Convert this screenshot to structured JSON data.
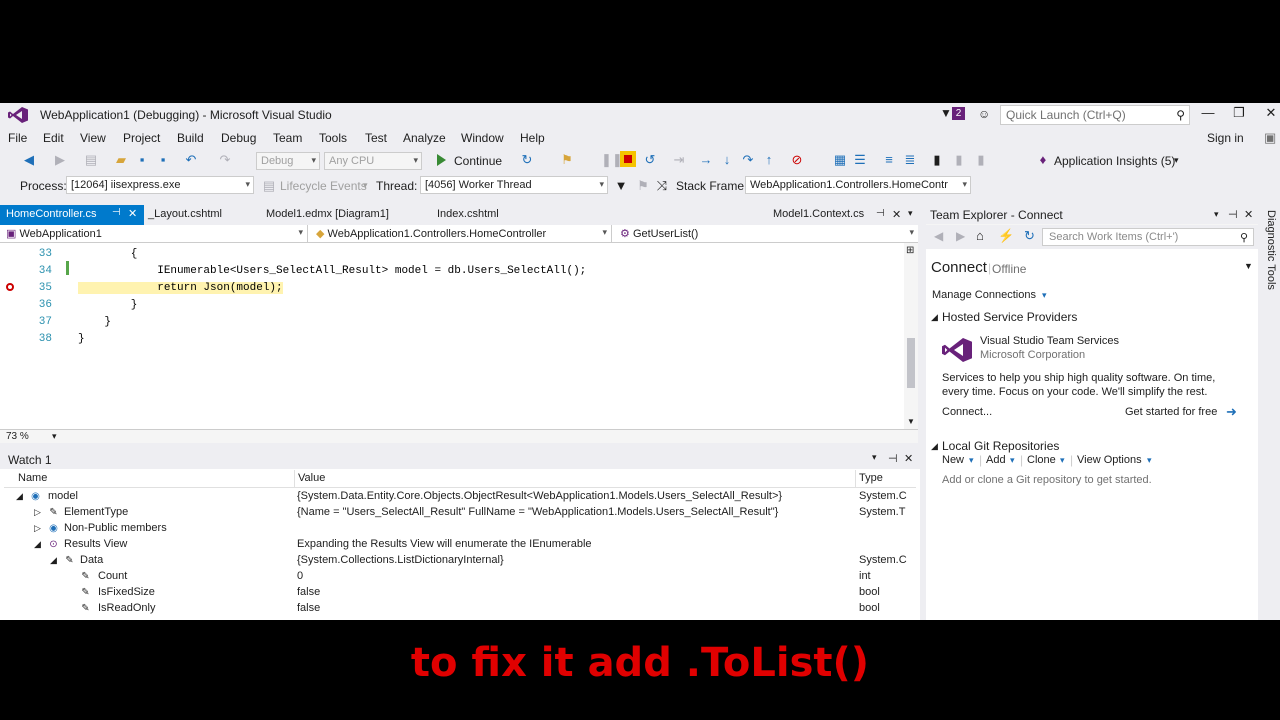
{
  "window": {
    "title": "WebApplication1 (Debugging) - Microsoft Visual Studio",
    "notification_count": "2",
    "quick_launch_placeholder": "Quick Launch (Ctrl+Q)"
  },
  "menu": [
    "File",
    "Edit",
    "View",
    "Project",
    "Build",
    "Debug",
    "Team",
    "Tools",
    "Test",
    "Analyze",
    "Window",
    "Help"
  ],
  "signin": "Sign in",
  "toolbar": {
    "config": "Debug",
    "platform": "Any CPU",
    "continue_label": "Continue",
    "app_insights": "Application Insights (5)",
    "process_label": "Process:",
    "process_value": "[12064] iisexpress.exe",
    "lifecycle_label": "Lifecycle Events",
    "thread_label": "Thread:",
    "thread_value": "[4056] Worker Thread",
    "stack_label": "Stack Frame:",
    "stack_value": "WebApplication1.Controllers.HomeContr"
  },
  "tabs": {
    "active": "HomeController.cs",
    "others": [
      "_Layout.cshtml",
      "Model1.edmx [Diagram1]",
      "Index.cshtml"
    ],
    "right": "Model1.Context.cs"
  },
  "nav": {
    "project": "WebApplication1",
    "class": "WebApplication1.Controllers.HomeController",
    "member": "GetUserList()"
  },
  "code": {
    "lines": [
      {
        "num": "33",
        "text": "        {"
      },
      {
        "num": "34",
        "text": "            IEnumerable<Users_SelectAll_Result> model = db.Users_SelectAll();"
      },
      {
        "num": "35",
        "text": "            return Json(model);"
      },
      {
        "num": "36",
        "text": "        }"
      },
      {
        "num": "37",
        "text": "    }"
      },
      {
        "num": "38",
        "text": "}"
      }
    ],
    "zoom": "73 %"
  },
  "watch": {
    "title": "Watch 1",
    "headers": [
      "Name",
      "Value",
      "Type"
    ],
    "rows": [
      {
        "name": "model",
        "value": "{System.Data.Entity.Core.Objects.ObjectResult<WebApplication1.Models.Users_SelectAll_Result>}",
        "type": "System.C"
      },
      {
        "name": "ElementType",
        "value": "{Name = \"Users_SelectAll_Result\" FullName = \"WebApplication1.Models.Users_SelectAll_Result\"}",
        "type": "System.T"
      },
      {
        "name": "Non-Public members",
        "value": "",
        "type": ""
      },
      {
        "name": "Results View",
        "value": "Expanding the Results View will enumerate the IEnumerable",
        "type": ""
      },
      {
        "name": "Data",
        "value": "{System.Collections.ListDictionaryInternal}",
        "type": "System.C"
      },
      {
        "name": "Count",
        "value": "0",
        "type": "int"
      },
      {
        "name": "IsFixedSize",
        "value": "false",
        "type": "bool"
      },
      {
        "name": "IsReadOnly",
        "value": "false",
        "type": "bool"
      }
    ]
  },
  "team_explorer": {
    "title": "Team Explorer - Connect",
    "search_placeholder": "Search Work Items (Ctrl+')",
    "heading": "Connect",
    "status": "Offline",
    "manage": "Manage Connections",
    "hosted_title": "Hosted Service Providers",
    "vsts_name": "Visual Studio Team Services",
    "vsts_company": "Microsoft Corporation",
    "vsts_desc1": "Services to help you ship high quality software. On time,",
    "vsts_desc2": "every time. Focus on your code. We'll simplify the rest.",
    "connect_link": "Connect...",
    "get_started": "Get started for free",
    "git_title": "Local Git Repositories",
    "git_new": "New",
    "git_add": "Add",
    "git_clone": "Clone",
    "git_view": "View Options",
    "git_hint": "Add or clone a Git repository to get started."
  },
  "side_tab": "Diagnostic Tools",
  "caption": "to fix it add .ToList()",
  "colors": {
    "accent": "#007acc",
    "caption": "#e00000",
    "vs_purple": "#68217a"
  }
}
